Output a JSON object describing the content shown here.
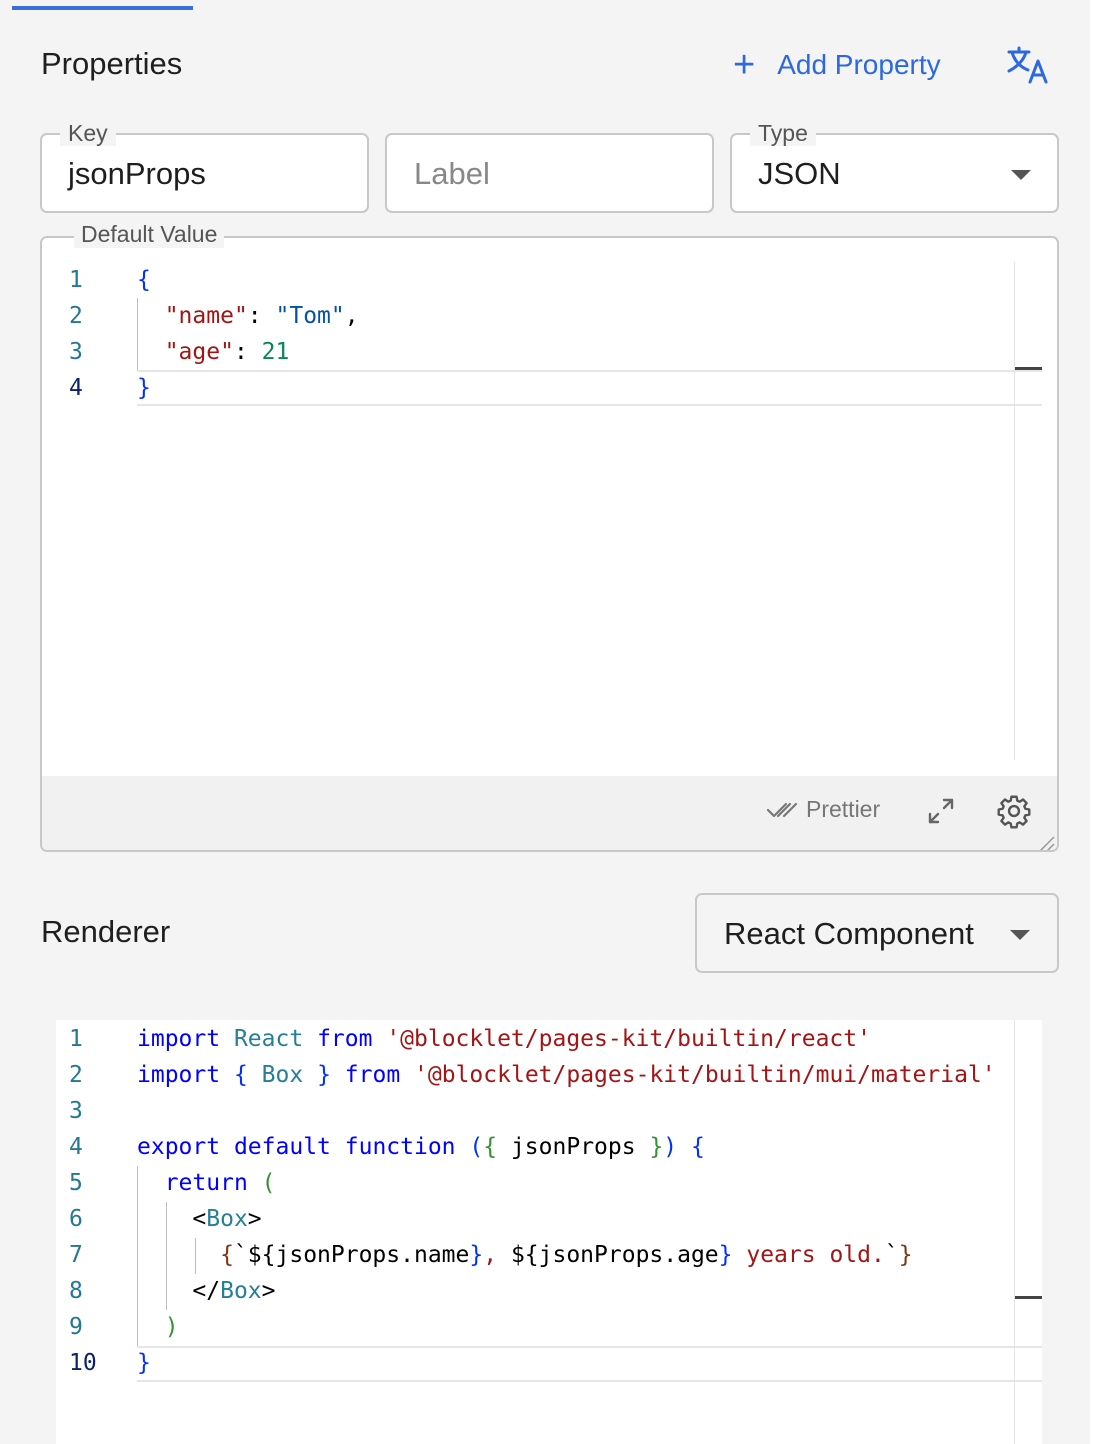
{
  "properties": {
    "title": "Properties",
    "add_label": "Add Property",
    "plus_glyph": "+",
    "add_icon": "plus-icon",
    "translate_icon": "translate-icon"
  },
  "key_field": {
    "legend": "Key",
    "value": "jsonProps"
  },
  "label_field": {
    "placeholder": "Label"
  },
  "type_field": {
    "legend": "Type",
    "value": "JSON"
  },
  "default_value": {
    "legend": "Default Value",
    "line_numbers": [
      "1",
      "2",
      "3",
      "4"
    ],
    "lines": [
      [
        [
          "{",
          "bb"
        ]
      ],
      [
        [
          "  ",
          ""
        ],
        [
          "\"name\"",
          "s"
        ],
        [
          ": ",
          ""
        ],
        [
          "\"Tom\"",
          "v"
        ],
        [
          ",",
          ""
        ]
      ],
      [
        [
          "  ",
          ""
        ],
        [
          "\"age\"",
          "s"
        ],
        [
          ": ",
          ""
        ],
        [
          "21",
          "n"
        ]
      ],
      [
        [
          "}",
          "bb"
        ]
      ]
    ]
  },
  "editor_toolbar": {
    "prettier_label": "Prettier",
    "prettier_icon": "double-check-icon",
    "expand_icon": "expand-icon",
    "settings_icon": "gear-icon"
  },
  "renderer": {
    "title": "Renderer",
    "select_value": "React Component",
    "line_numbers": [
      "1",
      "2",
      "3",
      "4",
      "5",
      "6",
      "7",
      "8",
      "9",
      "10"
    ],
    "lines": [
      [
        [
          "import",
          "k"
        ],
        [
          " ",
          ""
        ],
        [
          "React",
          "t"
        ],
        [
          " ",
          ""
        ],
        [
          "from",
          "k"
        ],
        [
          " ",
          ""
        ],
        [
          "'@blocklet/pages-kit/builtin/react'",
          "s"
        ]
      ],
      [
        [
          "import",
          "k"
        ],
        [
          " ",
          ""
        ],
        [
          "{",
          "bb"
        ],
        [
          " ",
          ""
        ],
        [
          "Box",
          "t"
        ],
        [
          " ",
          ""
        ],
        [
          "}",
          "bb"
        ],
        [
          " ",
          ""
        ],
        [
          "from",
          "k"
        ],
        [
          " ",
          ""
        ],
        [
          "'@blocklet/pages-kit/builtin/mui/material'",
          "s"
        ]
      ],
      [],
      [
        [
          "export",
          "k"
        ],
        [
          " ",
          ""
        ],
        [
          "default",
          "k"
        ],
        [
          " ",
          ""
        ],
        [
          "function",
          "k"
        ],
        [
          " ",
          ""
        ],
        [
          "(",
          "bb"
        ],
        [
          "{",
          "bg"
        ],
        [
          " jsonProps ",
          ""
        ],
        [
          "}",
          "bg"
        ],
        [
          ")",
          "bb"
        ],
        [
          " ",
          ""
        ],
        [
          "{",
          "bb"
        ]
      ],
      [
        [
          "  ",
          ""
        ],
        [
          "return",
          "k"
        ],
        [
          " ",
          ""
        ],
        [
          "(",
          "bg"
        ]
      ],
      [
        [
          "    ",
          ""
        ],
        [
          "<",
          ""
        ],
        [
          "Box",
          "t"
        ],
        [
          ">",
          ""
        ]
      ],
      [
        [
          "      ",
          ""
        ],
        [
          "{",
          "by"
        ],
        [
          "`${",
          ""
        ],
        [
          "jsonProps.name",
          ""
        ],
        [
          "}",
          "bb"
        ],
        [
          ", ",
          "s"
        ],
        [
          "${",
          ""
        ],
        [
          "jsonProps.age",
          ""
        ],
        [
          "}",
          "bb"
        ],
        [
          " years old.",
          "s"
        ],
        [
          "`",
          ""
        ],
        [
          "}",
          "by"
        ]
      ],
      [
        [
          "    ",
          ""
        ],
        [
          "</",
          ""
        ],
        [
          "Box",
          "t"
        ],
        [
          ">",
          ""
        ]
      ],
      [
        [
          "  ",
          ""
        ],
        [
          ")",
          "bg"
        ]
      ],
      [
        [
          "}",
          "bb"
        ]
      ]
    ]
  }
}
